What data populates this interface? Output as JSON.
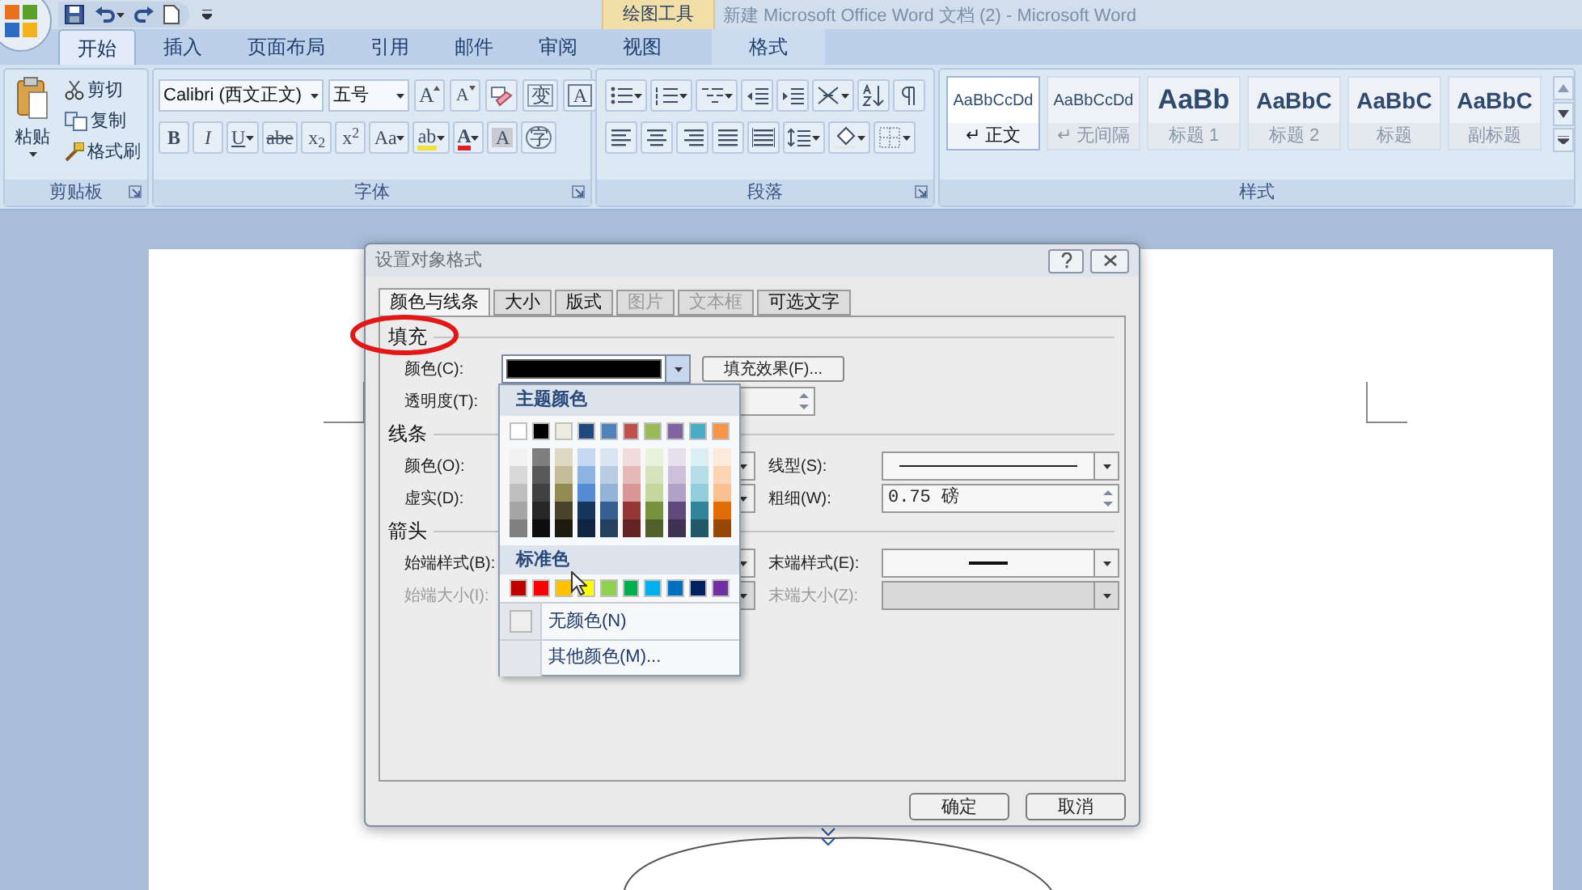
{
  "title_bar": {
    "contextual_group": "绘图工具",
    "title": "新建 Microsoft Office Word 文档 (2) - Microsoft Word"
  },
  "ribbon_tabs": [
    {
      "label": "开始",
      "selected": true,
      "kind": "standard"
    },
    {
      "label": "插入",
      "selected": false,
      "kind": "standard"
    },
    {
      "label": "页面布局",
      "selected": false,
      "kind": "standard"
    },
    {
      "label": "引用",
      "selected": false,
      "kind": "standard"
    },
    {
      "label": "邮件",
      "selected": false,
      "kind": "standard"
    },
    {
      "label": "审阅",
      "selected": false,
      "kind": "standard"
    },
    {
      "label": "视图",
      "selected": false,
      "kind": "standard"
    },
    {
      "label": "格式",
      "selected": false,
      "kind": "contextual"
    }
  ],
  "clipboard": {
    "paste": "粘贴",
    "actions": [
      {
        "kind": "cut",
        "label": "剪切"
      },
      {
        "kind": "copy",
        "label": "复制"
      },
      {
        "kind": "painter",
        "label": "格式刷"
      }
    ],
    "group_label": "剪贴板"
  },
  "font": {
    "name": "Calibri (西文正文)",
    "size": "五号",
    "group_label": "字体",
    "row1": [
      {
        "kind": "grow",
        "text": "A"
      },
      {
        "kind": "shrink",
        "text": "A"
      },
      {
        "kind": "clear"
      },
      {
        "kind": "phonetic",
        "text": "变"
      },
      {
        "kind": "border",
        "text": "A"
      }
    ],
    "row2": [
      {
        "kind": "bold",
        "text": "B"
      },
      {
        "kind": "italic",
        "text": "I"
      },
      {
        "kind": "underline",
        "text": "U"
      },
      {
        "kind": "strike",
        "text": "abe"
      },
      {
        "kind": "sub",
        "text": "x$_{2}$"
      },
      {
        "kind": "sup",
        "text": "x$^{2}$"
      },
      {
        "kind": "case",
        "text": "Aa"
      },
      {
        "kind": "highlight",
        "text": "ab"
      },
      {
        "kind": "color",
        "text": "A"
      },
      {
        "kind": "shade",
        "text": "A"
      },
      {
        "kind": "enclose",
        "text": "字"
      }
    ]
  },
  "paragraph": {
    "group_label": "段落"
  },
  "styles": {
    "group_label": "样式",
    "items": [
      {
        "preview": "AaBbCcDd",
        "name": "↵ 正文",
        "selected": true,
        "kind": "body"
      },
      {
        "preview": "AaBbCcDd",
        "name": "↵ 无间隔",
        "selected": false,
        "kind": "body"
      },
      {
        "preview": "AaBb",
        "name": "标题 1",
        "selected": false,
        "kind": "heading"
      },
      {
        "preview": "AaBbC",
        "name": "标题 2",
        "selected": false,
        "kind": "heading"
      },
      {
        "preview": "AaBbC",
        "name": "标题",
        "selected": false,
        "kind": "title"
      },
      {
        "preview": "AaBbC",
        "name": "副标题",
        "selected": false,
        "kind": "subtitle"
      }
    ]
  },
  "dialog": {
    "title": "设置对象格式",
    "tabs": [
      {
        "label": "颜色与线条",
        "selected": true,
        "disabled": false
      },
      {
        "label": "大小",
        "selected": false,
        "disabled": false
      },
      {
        "label": "版式",
        "selected": false,
        "disabled": false
      },
      {
        "label": "图片",
        "selected": false,
        "disabled": true
      },
      {
        "label": "文本框",
        "selected": false,
        "disabled": true
      },
      {
        "label": "可选文字",
        "selected": false,
        "disabled": false
      }
    ],
    "fill": {
      "heading": "填充",
      "color_label": "颜色(C):",
      "color": "#000000",
      "effects_button": "填充效果(F)...",
      "transparency_label": "透明度(T):"
    },
    "line": {
      "heading": "线条",
      "color_label": "颜色(O):",
      "style_label": "线型(S):",
      "dash_label": "虚实(D):",
      "weight_label": "粗细(W):",
      "weight_value": "0.75 磅"
    },
    "arrows": {
      "heading": "箭头",
      "begin_style_label": "始端样式(B):",
      "end_style_label": "末端样式(E):",
      "begin_size_label": "始端大小(I):",
      "end_size_label": "末端大小(Z):",
      "sizes_disabled": true
    },
    "buttons": [
      "确定",
      "取消"
    ]
  },
  "color_menu": {
    "theme_heading": "主题颜色",
    "theme_colors": [
      {
        "color": "#ffffff",
        "shades": [
          {
            "color": "#f2f2f2"
          },
          {
            "color": "#d9d9d9"
          },
          {
            "color": "#bfbfbf"
          },
          {
            "color": "#a6a6a6"
          },
          {
            "color": "#808080"
          }
        ]
      },
      {
        "color": "#000000",
        "shades": [
          {
            "color": "#7f7f7f"
          },
          {
            "color": "#595959"
          },
          {
            "color": "#404040"
          },
          {
            "color": "#262626"
          },
          {
            "color": "#0d0d0d"
          }
        ]
      },
      {
        "color": "#eeece1",
        "shades": [
          {
            "color": "#ddd9c3"
          },
          {
            "color": "#c4bd97"
          },
          {
            "color": "#938953"
          },
          {
            "color": "#494429"
          },
          {
            "color": "#1d1b10"
          }
        ]
      },
      {
        "color": "#1f497d",
        "shades": [
          {
            "color": "#c6d9f0"
          },
          {
            "color": "#8db3e2"
          },
          {
            "color": "#548dd4"
          },
          {
            "color": "#17365d"
          },
          {
            "color": "#0f243e"
          }
        ]
      },
      {
        "color": "#4f81bd",
        "shades": [
          {
            "color": "#dbe5f1"
          },
          {
            "color": "#b8cce4"
          },
          {
            "color": "#95b3d7"
          },
          {
            "color": "#366092"
          },
          {
            "color": "#244061"
          }
        ]
      },
      {
        "color": "#c0504d",
        "shades": [
          {
            "color": "#f2dcdb"
          },
          {
            "color": "#e5b9b7"
          },
          {
            "color": "#d99694"
          },
          {
            "color": "#953734"
          },
          {
            "color": "#632423"
          }
        ]
      },
      {
        "color": "#9bbb59",
        "shades": [
          {
            "color": "#ebf1dd"
          },
          {
            "color": "#d7e3bc"
          },
          {
            "color": "#c3d69b"
          },
          {
            "color": "#76923c"
          },
          {
            "color": "#4f6128"
          }
        ]
      },
      {
        "color": "#8064a2",
        "shades": [
          {
            "color": "#e5e0ec"
          },
          {
            "color": "#ccc1d9"
          },
          {
            "color": "#b2a2c7"
          },
          {
            "color": "#5f497a"
          },
          {
            "color": "#3f3151"
          }
        ]
      },
      {
        "color": "#4bacc6",
        "shades": [
          {
            "color": "#dbeef3"
          },
          {
            "color": "#b7dde8"
          },
          {
            "color": "#92cddc"
          },
          {
            "color": "#31859b"
          },
          {
            "color": "#205867"
          }
        ]
      },
      {
        "color": "#f79646",
        "shades": [
          {
            "color": "#fdeada"
          },
          {
            "color": "#fbd5b5"
          },
          {
            "color": "#fac08f"
          },
          {
            "color": "#e36c09"
          },
          {
            "color": "#974806"
          }
        ]
      }
    ],
    "standard_heading": "标准色",
    "standard_colors": [
      {
        "color": "#c00000"
      },
      {
        "color": "#ff0000"
      },
      {
        "color": "#ffc000"
      },
      {
        "color": "#ffff00"
      },
      {
        "color": "#92d050"
      },
      {
        "color": "#00b050"
      },
      {
        "color": "#00b0f0"
      },
      {
        "color": "#0070c0"
      },
      {
        "color": "#002060"
      },
      {
        "color": "#7030a0"
      }
    ],
    "no_color": "无颜色(N)",
    "more_colors": "其他颜色(M)..."
  }
}
